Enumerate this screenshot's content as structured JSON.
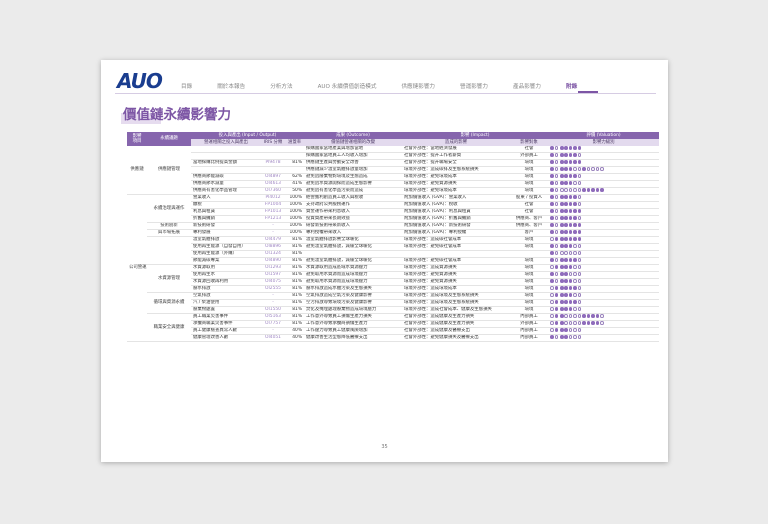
{
  "brand": {
    "logo_text": "AUO"
  },
  "nav": [
    "目錄",
    "關於本報告",
    "分析方法",
    "AUO 永續價值創造模式",
    "供應鏈影響力",
    "營運影響力",
    "產品影響力",
    "附錄"
  ],
  "nav_active_index": 7,
  "page_title": "價值鏈永續影響力",
  "table": {
    "group_headers": [
      "影響\n項目",
      "永續議題",
      "投入與產出 (Input / Output)",
      "成果 (Outcome)",
      "影響 (Impact)",
      "評價 (Valuation)"
    ],
    "sub_headers": [
      "營運相關之投入與產出",
      "IRIS 分類",
      "涵蓋率",
      "價值鏈營運相關的改變",
      "造成的影響",
      "影響對象",
      "影響力級別"
    ],
    "rows": [
      {
        "cat1": "供應鏈",
        "cat2": "供應鏈管理",
        "io": "",
        "iris": "",
        "pct": "",
        "outcome": "採購國家當地產業與增加當地",
        "impact": "社會外部性：當地經濟發展",
        "target": "社會",
        "rating": "",
        "g1": "",
        "g2": ""
      },
      {
        "cat1": "",
        "cat2": "",
        "io": "",
        "iris": "",
        "pct": "",
        "outcome": "採購國家當地員工人均收入增加",
        "impact": "社會外部性：提升工作者薪資",
        "target": "外部員工",
        "rating": "",
        "g1": "",
        "g2": ""
      },
      {
        "cat1": "",
        "cat2": "",
        "io": "當地採購比例提高金額",
        "iris": "PI9478",
        "pct": "81%",
        "outcome": "供應鏈生產與勞動安全改善",
        "impact": "社會外部性：提升職場安全",
        "target": "環境",
        "rating": "",
        "g1": "",
        "g2": ""
      },
      {
        "cat1": "",
        "cat2": "",
        "io": "",
        "iris": "",
        "pct": "",
        "outcome": "供應鏈減少溫室氣體排放量增加",
        "impact": "環境外部性：造成碳排及生態系統損失",
        "target": "環境",
        "rating": "",
        "g1": "",
        "g2": ""
      },
      {
        "cat1": "",
        "cat2": "",
        "io": "供應商節能減碳",
        "iris": "OI4897",
        "pct": "62%",
        "outcome": "避免因廢棄物對環境及生態造成",
        "impact": "環境外部性：避免環境成本",
        "target": "環境",
        "rating": "",
        "g1": "",
        "g2": ""
      },
      {
        "cat1": "",
        "cat2": "",
        "io": "供應商節水減量",
        "iris": "OI4613",
        "pct": "41%",
        "outcome": "避免因水資源開採而造成生態影響",
        "impact": "環境外部性：避免資源損失",
        "target": "環境",
        "rating": "",
        "g1": "",
        "g2": ""
      },
      {
        "cat1": "",
        "cat2": "",
        "io": "供應商有害化學品管理",
        "iris": "OI7360",
        "pct": "50%",
        "outcome": "避免因有害化學品污染而造成",
        "impact": "環境外部性：避免環境成本",
        "target": "環境",
        "rating": "",
        "g1": "",
        "g2": ""
      },
      {
        "cat1": "公司營運",
        "cat2": "永續治理與運作",
        "io": "營業收入",
        "iris": "PI4012",
        "pct": "100%",
        "outcome": "經營獲利創造員工收入與稅收",
        "impact": "附加價值收入 (GVA)：營業收入",
        "target": "股東 / 投資人",
        "rating": "",
        "g1": "",
        "g2": ""
      },
      {
        "cat1": "",
        "cat2": "",
        "io": "繳稅",
        "iris": "FP1004",
        "pct": "100%",
        "outcome": "支持政府公共服務運作",
        "impact": "附加價值收入 (GVA)：稅收",
        "target": "社會",
        "rating": "",
        "g1": "",
        "g2": ""
      },
      {
        "cat1": "",
        "cat2": "",
        "io": "利息與租賃",
        "iris": "FP1013",
        "pct": "100%",
        "outcome": "資金運作帶來利息收入",
        "impact": "附加價值收入 (GVA)：利息與租賃",
        "target": "社會",
        "rating": "",
        "g1": "",
        "g2": ""
      },
      {
        "cat1": "",
        "cat2": "",
        "io": "折舊與攤銷",
        "iris": "FP1213",
        "pct": "100%",
        "outcome": "投資資產帶來長期效益",
        "impact": "附加價值收入 (GVA)：折舊與攤銷",
        "target": "供應商、客戶",
        "rating": "",
        "g1": "",
        "g2": ""
      },
      {
        "cat1": "",
        "cat2": "技術創新",
        "io": "新技術研發",
        "iris": "-",
        "pct": "100%",
        "outcome": "研發新技術帶來新收入",
        "impact": "附加價值收入 (GVA)：新技術研發",
        "target": "供應商、客戶",
        "rating": "",
        "g1": "",
        "g2": ""
      },
      {
        "cat1": "",
        "cat2": "與市場拓展",
        "io": "專利發展",
        "iris": "-",
        "pct": "100%",
        "outcome": "專利授權帶來收入",
        "impact": "附加價值收入 (GVA)：專利授權",
        "target": "客戶",
        "rating": "",
        "g1": "",
        "g2": ""
      },
      {
        "cat1": "",
        "cat2": "",
        "io": "溫室氣體排放",
        "iris": "OI4479",
        "pct": "81%",
        "outcome": "溫室氣體排放影響全球暖化",
        "impact": "環境外部性：造成碳社會成本",
        "target": "環境",
        "rating": "",
        "g1": "",
        "g2": ""
      },
      {
        "cat1": "",
        "cat2": "氣候變遷",
        "io": "使用再生能源（自發自用）",
        "iris": "OI8896",
        "pct": "81%",
        "outcome": "避免溫室氣體排放，減緩全球暖化",
        "impact": "環境外部性：避免碳社會成本",
        "target": "環境",
        "rating": "",
        "g1": "",
        "g2": ""
      },
      {
        "cat1": "",
        "cat2": "與能源管理",
        "io": "使用再生能源（外購）",
        "iris": "OI1324",
        "pct": "81%",
        "outcome": "",
        "impact": "",
        "target": "",
        "rating": "",
        "g1": "",
        "g2": ""
      },
      {
        "cat1": "",
        "cat2": "",
        "io": "節能減碳專案",
        "iris": "OI4890",
        "pct": "81%",
        "outcome": "避免溫室氣體排放，減緩全球暖化",
        "impact": "環境外部性：避免碳社會成本",
        "target": "環境",
        "rating": "",
        "g1": "",
        "g2": ""
      },
      {
        "cat1": "",
        "cat2": "水資源管理",
        "io": "水資源取用",
        "iris": "OI1293",
        "pct": "81%",
        "outcome": "水資源取用造成區域水資源壓力",
        "impact": "環境外部性：造成資源損失",
        "target": "環境",
        "rating": "",
        "g1": "",
        "g2": ""
      },
      {
        "cat1": "",
        "cat2": "",
        "io": "使用再生水",
        "iris": "OI1597",
        "pct": "81%",
        "outcome": "避免取用水資源而造成環境壓力",
        "impact": "環境外部性：避免資源損失",
        "target": "環境",
        "rating": "",
        "g1": "",
        "g2": ""
      },
      {
        "cat1": "",
        "cat2": "",
        "io": "水資源回收再利用",
        "iris": "OI4075",
        "pct": "81%",
        "outcome": "避免取用水資源而造成環境壓力",
        "impact": "環境外部性：避免資源損失",
        "target": "環境",
        "rating": "",
        "g1": "",
        "g2": ""
      },
      {
        "cat1": "",
        "cat2": "",
        "io": "廢水排放",
        "iris": "OI2555",
        "pct": "81%",
        "outcome": "廢水排放造成水體污染及生態損失",
        "impact": "環境外部性：造成環境成本",
        "target": "環境",
        "rating": "",
        "g1": "",
        "g2": ""
      },
      {
        "cat1": "",
        "cat2": "循環與資源永續",
        "io": "空氣排放",
        "iris": "-",
        "pct": "81%",
        "outcome": "空氣排放造成空氣污染及健康影響",
        "impact": "環境外部性：造成環境及生態系統損失",
        "target": "環境",
        "rating": "",
        "g1": "",
        "g2": ""
      },
      {
        "cat1": "",
        "cat2": "",
        "io": "汽 / 柴油使用",
        "iris": "-",
        "pct": "81%",
        "outcome": "空污排放導致環境污染及健康影響",
        "impact": "環境外部性：造成環境及生態系統損失",
        "target": "環境",
        "rating": "",
        "g1": "",
        "g2": ""
      },
      {
        "cat1": "",
        "cat2": "",
        "io": "廢棄物處置",
        "iris": "OI1550",
        "pct": "81%",
        "outcome": "焚化及掩埋處理廢棄物造成環境壓力",
        "impact": "環境外部性：造成社會成本、健康及生態損失",
        "target": "環境",
        "rating": "",
        "g1": "",
        "g2": ""
      },
      {
        "cat1": "",
        "cat2": "職業安全與健康",
        "io": "員工職業災害事件",
        "iris": "OI5163",
        "pct": "81%",
        "outcome": "工作意外導致員工損傷生產力損失",
        "impact": "社會外部性：造成健康及生產力損失",
        "target": "內部員工",
        "rating": "",
        "g1": "",
        "g2": ""
      },
      {
        "cat1": "",
        "cat2": "",
        "io": "承攬商職業災害事件",
        "iris": "OI7757",
        "pct": "81%",
        "outcome": "工作意外導致承攬商損傷生產力",
        "impact": "社會外部性：造成健康及生產力損失",
        "target": "外部員工",
        "rating": "",
        "g1": "",
        "g2": ""
      },
      {
        "cat1": "",
        "cat2": "",
        "io": "員工健康檢查異常人數",
        "iris": "-",
        "pct": "40%",
        "outcome": "工作壓力導致員工健康風險增加",
        "impact": "社會外部性：造成健康及醫療支出",
        "target": "內部員工",
        "rating": "",
        "g1": "",
        "g2": ""
      },
      {
        "cat1": "",
        "cat2": "",
        "io": "健康管理改善人數",
        "iris": "OI4051",
        "pct": "40%",
        "outcome": "健康改善生活型態降低醫療支出",
        "impact": "社會外部性：避免健康損失及醫療支出",
        "target": "內部員工",
        "rating": "",
        "g1": "",
        "g2": ""
      }
    ],
    "ratings": [
      [
        1,
        0,
        5,
        0
      ],
      [
        1,
        0,
        4,
        0
      ],
      [
        1,
        0,
        5,
        0
      ],
      [
        1,
        0,
        3,
        1
      ],
      [
        1,
        0,
        4,
        0
      ],
      [
        1,
        0,
        3,
        0
      ],
      [
        1,
        0,
        0,
        5
      ],
      [
        1,
        0,
        4,
        0
      ],
      [
        1,
        0,
        4,
        0
      ],
      [
        1,
        0,
        5,
        0
      ],
      [
        1,
        0,
        4,
        0
      ],
      [
        1,
        0,
        5,
        0
      ],
      [
        1,
        0,
        5,
        0
      ],
      [
        0,
        1,
        5,
        0
      ],
      [
        1,
        0,
        3,
        0
      ],
      [
        1,
        0,
        0,
        0
      ],
      [
        1,
        0,
        4,
        0
      ],
      [
        0,
        1,
        3,
        0
      ],
      [
        1,
        0,
        2,
        0
      ],
      [
        1,
        0,
        3,
        0
      ],
      [
        0,
        1,
        4,
        0
      ],
      [
        0,
        1,
        3,
        0
      ],
      [
        0,
        1,
        4,
        0
      ],
      [
        0,
        1,
        3,
        0
      ],
      [
        0,
        1,
        1,
        4
      ],
      [
        0,
        1,
        1,
        4
      ],
      [
        0,
        1,
        2,
        0
      ],
      [
        1,
        0,
        2,
        0
      ]
    ]
  },
  "page_number": "35"
}
